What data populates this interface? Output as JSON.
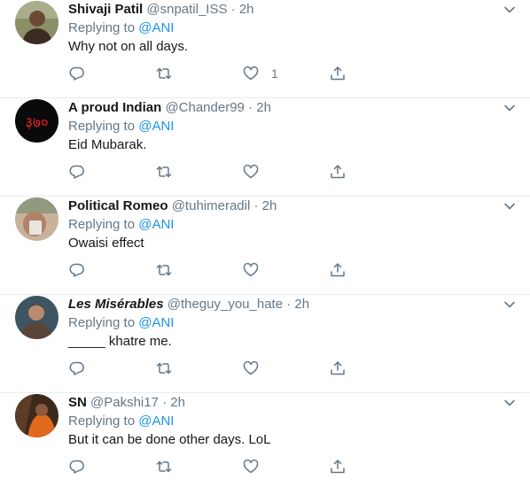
{
  "replying_label": "Replying to",
  "separator": "·",
  "tweets": [
    {
      "name": "Shivaji Patil",
      "handle": "@snpatil_ISS",
      "time": "2h",
      "reply_to": "@ANI",
      "text": "Why not on all days.",
      "like_count": "1",
      "italic": false,
      "avatar": {
        "bg": "#8a8f6a",
        "fg": "#3a2c22",
        "text": ""
      }
    },
    {
      "name": "A proud Indian",
      "handle": "@Chander99",
      "time": "2h",
      "reply_to": "@ANI",
      "text": "Eid Mubarak.",
      "like_count": "",
      "italic": false,
      "avatar": {
        "bg": "#0a0a0a",
        "fg": "#e0221b",
        "text": "३७०"
      }
    },
    {
      "name": "Political Romeo",
      "handle": "@tuhimeradil",
      "time": "2h",
      "reply_to": "@ANI",
      "text": "Owaisi effect",
      "like_count": "",
      "italic": false,
      "avatar": {
        "bg": "#c9b29a",
        "fg": "#6c4e3a",
        "text": ""
      }
    },
    {
      "name": "Les Misérables",
      "handle": "@theguy_you_hate",
      "time": "2h",
      "reply_to": "@ANI",
      "text": "_____ khatre me.",
      "like_count": "",
      "italic": true,
      "avatar": {
        "bg": "#3d5560",
        "fg": "#b88b6e",
        "text": ""
      }
    },
    {
      "name": "SN",
      "handle": "@Pakshi17",
      "time": "2h",
      "reply_to": "@ANI",
      "text": "But it can be done other days. LoL",
      "like_count": "",
      "italic": false,
      "avatar": {
        "bg": "#3e2a1c",
        "fg": "#e06a1e",
        "text": ""
      }
    }
  ],
  "icons": {
    "reply": "reply-icon",
    "retweet": "retweet-icon",
    "like": "like-icon",
    "share": "share-icon",
    "more": "chevron-down-icon"
  },
  "colors": {
    "text": "#14171a",
    "muted": "#657786",
    "link": "#1b95e0",
    "divider": "#e6ecf0"
  }
}
